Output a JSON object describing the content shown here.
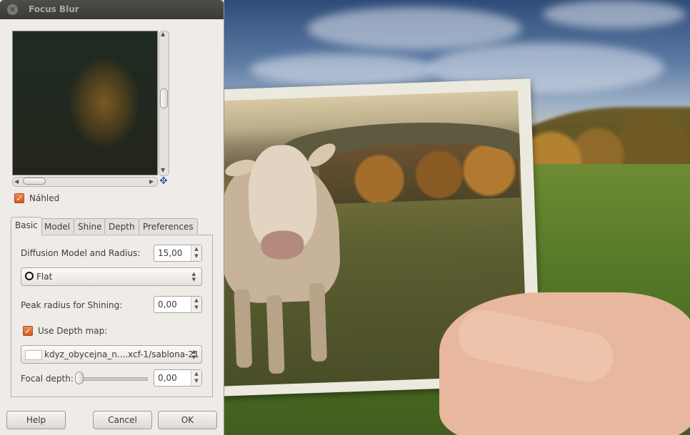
{
  "window": {
    "title": "Focus Blur"
  },
  "preview": {
    "checkbox_label": "Náhled",
    "checked": true
  },
  "tabs": [
    {
      "label": "Basic",
      "active": true
    },
    {
      "label": "Model",
      "active": false
    },
    {
      "label": "Shine",
      "active": false
    },
    {
      "label": "Depth",
      "active": false
    },
    {
      "label": "Preferences",
      "active": false
    }
  ],
  "basic": {
    "diffusion_label": "Diffusion Model and Radius:",
    "diffusion_value": "15,00",
    "model_select": "Flat",
    "peak_label": "Peak radius for Shining:",
    "peak_value": "0,00",
    "depth_map_label": "Use Depth map:",
    "depth_map_checked": true,
    "depth_map_select": "kdyz_obycejna_n....xcf-1/sablona-21",
    "focal_label": "Focal depth:",
    "focal_value": "0,00",
    "focal_slider": 0
  },
  "buttons": {
    "help": "Help",
    "cancel": "Cancel",
    "ok": "OK"
  },
  "icons": {
    "close": "close-icon",
    "navigate": "navigate-icon",
    "circle": "circle-icon"
  }
}
